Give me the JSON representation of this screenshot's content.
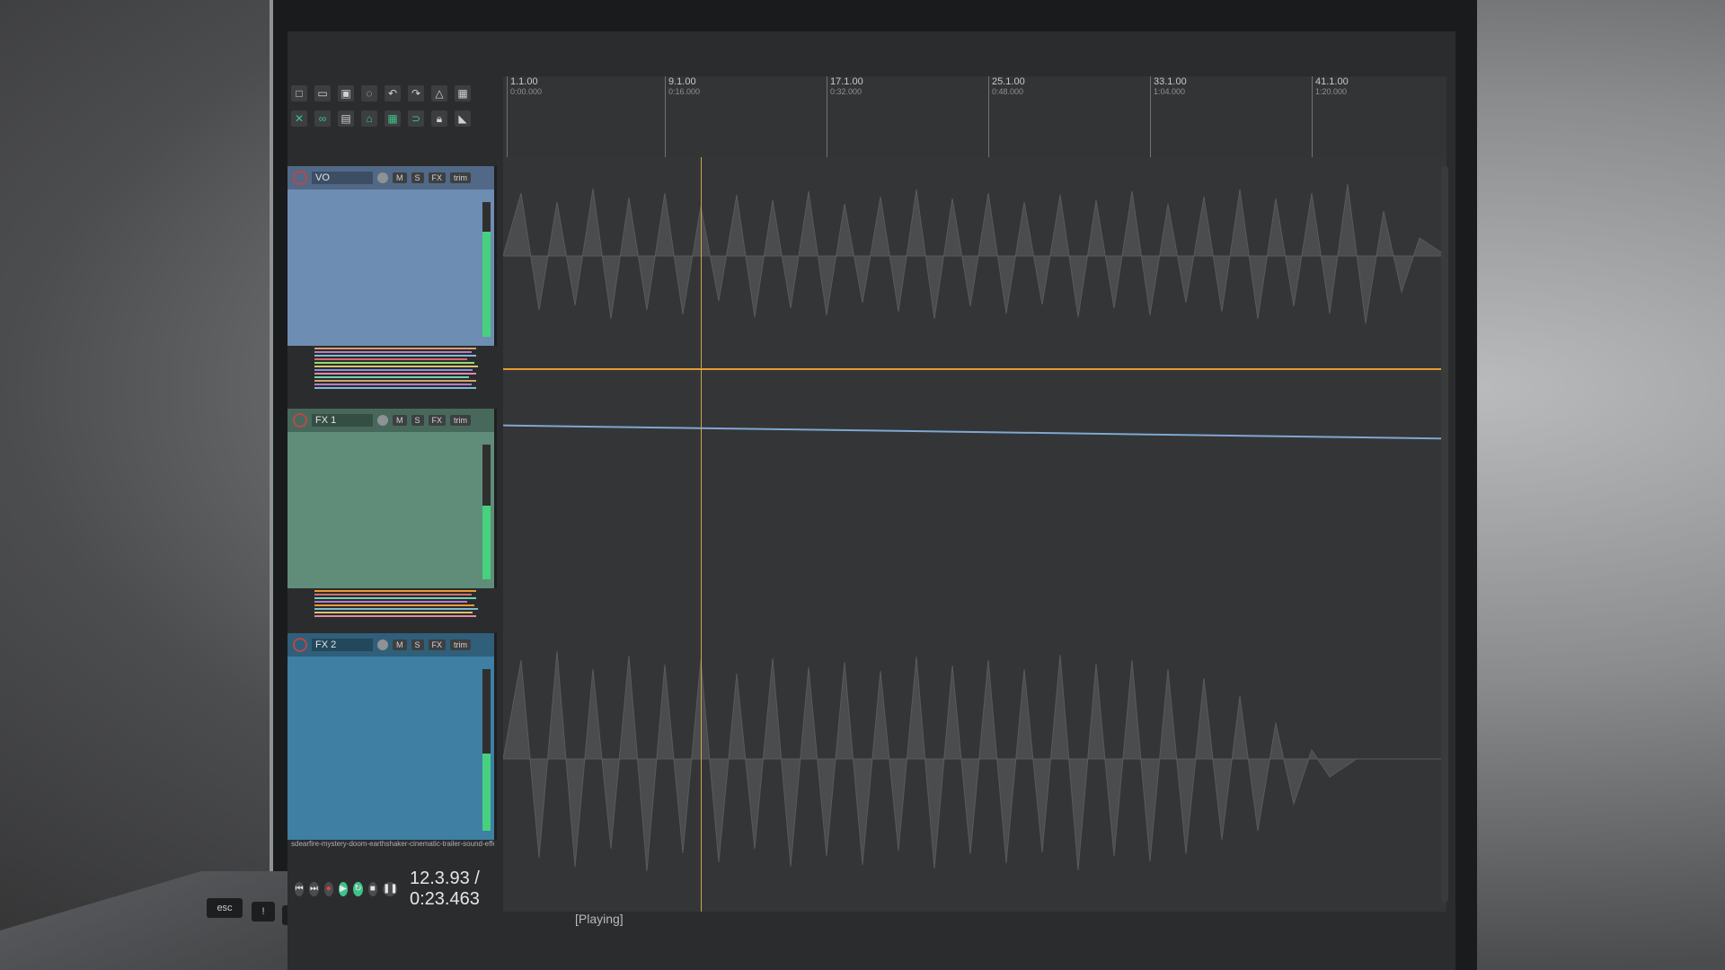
{
  "ruler": {
    "marks": [
      {
        "label": "1.1.00",
        "sub": "0:00.000"
      },
      {
        "label": "9.1.00",
        "sub": "0:16.000"
      },
      {
        "label": "17.1.00",
        "sub": "0:32.000"
      },
      {
        "label": "25.1.00",
        "sub": "0:48.000"
      },
      {
        "label": "33.1.00",
        "sub": "1:04.000"
      },
      {
        "label": "41.1.00",
        "sub": "1:20.000"
      }
    ]
  },
  "tracks": [
    {
      "name": "VO",
      "color": "#6d8db3",
      "mute": "M",
      "solo": "S",
      "fx": "FX",
      "route": "trim",
      "meter_fill_percent": 78
    },
    {
      "name": "FX 1",
      "color": "#5f8d7a",
      "mute": "M",
      "solo": "S",
      "fx": "FX",
      "route": "trim",
      "meter_fill_percent": 55
    },
    {
      "name": "FX 2",
      "color": "#3f7fa3",
      "mute": "M",
      "solo": "S",
      "fx": "FX",
      "route": "trim",
      "meter_fill_percent": 48
    }
  ],
  "transport": {
    "time": "12.3.93 / 0:23.463",
    "file": "sdearfire-mystery-doom-earthshaker-cinematic-trailer-sound-effects-183248 [Input] Input 1"
  },
  "status": "[Playing]",
  "keyboard": {
    "esc": "esc",
    "k1": "!",
    "k2": "@",
    "k3": "#"
  },
  "colors": {
    "accent_green": "#3ec28a",
    "playcursor": "#c9a648",
    "envelope_orange": "#e69a33",
    "envelope_blue": "#7ea7d1"
  }
}
